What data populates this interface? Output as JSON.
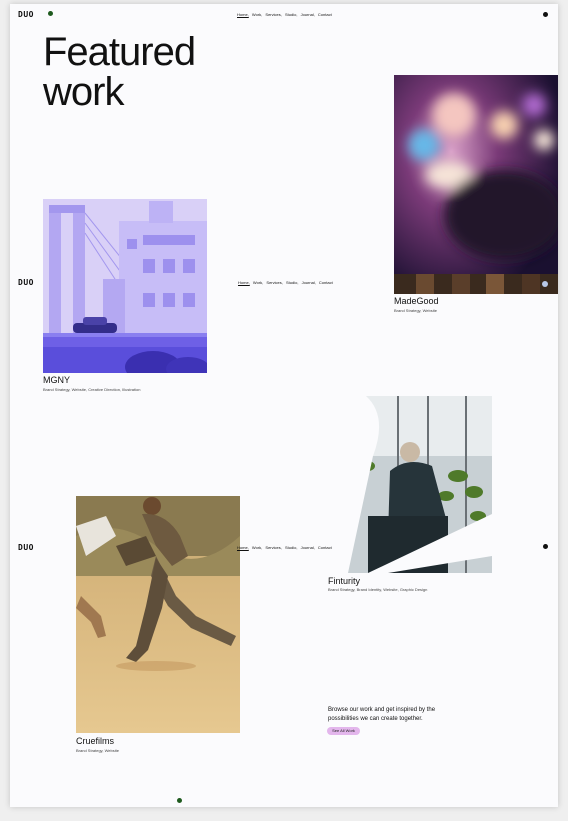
{
  "logo": "DUO",
  "nav": {
    "items": [
      "Home,",
      "Work,",
      "Services,",
      "Studio,",
      "Journal,",
      "Contact"
    ]
  },
  "title": {
    "line1": "Featured",
    "line2": "work"
  },
  "projects": [
    {
      "title": "MadeGood",
      "subtitle": "Brand Strategy, Website"
    },
    {
      "title": "MGNY",
      "subtitle": "Brand Strategy, Website, Creative Direction, Illustration"
    },
    {
      "title": "Finturity",
      "subtitle": "Brand Strategy, Brand Identity, Website, Graphic Design"
    },
    {
      "title": "Cruefilms",
      "subtitle": "Brand Strategy, Website"
    }
  ],
  "cta": {
    "text": "Browse our work and get inspired by the possibilities we can create together.",
    "button": "See All Work"
  },
  "colors": {
    "accent_button": "#e3b6ec",
    "dot_green": "#1e5a1e",
    "mgny_purple": "#7b6ef0"
  }
}
